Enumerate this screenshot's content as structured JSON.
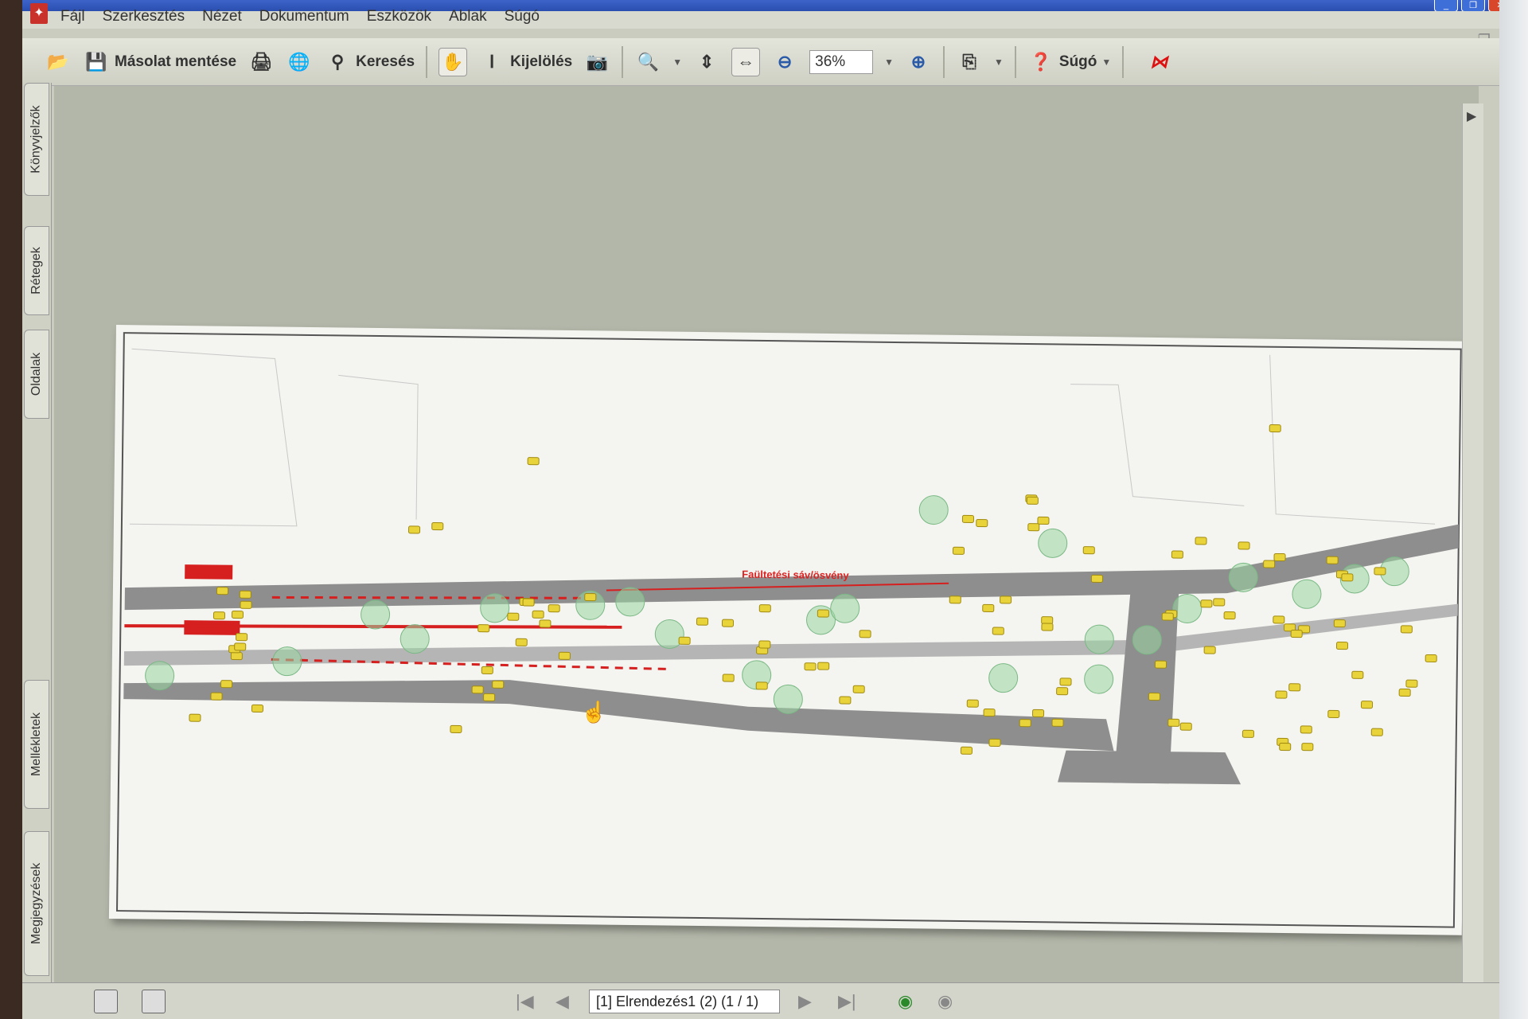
{
  "menubar": {
    "items": [
      "Fájl",
      "Szerkesztés",
      "Nézet",
      "Dokumentum",
      "Eszközök",
      "Ablak",
      "Súgó"
    ]
  },
  "toolbar": {
    "save_copy_label": "Másolat mentése",
    "search_label": "Keresés",
    "select_label": "Kijelölés",
    "zoom_value": "36%",
    "help_label": "Súgó"
  },
  "sidetabs": {
    "bookmarks": "Könyvjelzők",
    "layers": "Rétegek",
    "pages": "Oldalak",
    "attachments": "Mellékletek",
    "comments": "Megjegyzések"
  },
  "drawing": {
    "red_label": "Faültetési sáv/ösvény"
  },
  "statusbar": {
    "page_field": "[1] Elrendezés1 (2) (1 / 1)"
  },
  "colors": {
    "annotation": "#e8d33a",
    "road": "#8e8e8e",
    "highlight": "#d61f1f",
    "tree": "#9bd6a3"
  }
}
